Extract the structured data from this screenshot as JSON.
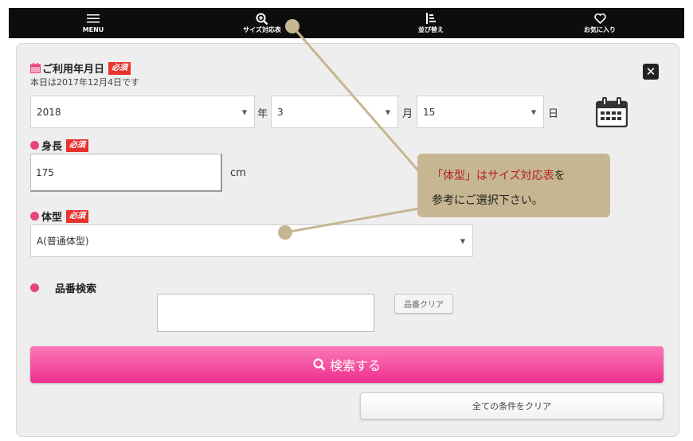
{
  "nav": {
    "items": [
      {
        "label": "MENU",
        "icon": "hamburger-menu-icon"
      },
      {
        "label": "サイズ対応表",
        "icon": "zoom-in-icon"
      },
      {
        "label": "並び替え",
        "icon": "sort-icon"
      },
      {
        "label": "お気に入り",
        "icon": "heart-icon"
      }
    ]
  },
  "birthdate": {
    "label": "ご利用年月日",
    "required": "必須",
    "today_text": "本日は2017年12月4日です",
    "year": {
      "value": "2018",
      "unit": "年"
    },
    "month": {
      "value": "3",
      "unit": "月"
    },
    "day": {
      "value": "15",
      "unit": "日"
    }
  },
  "height": {
    "label": "身長",
    "required": "必須",
    "value": "175",
    "unit": "cm"
  },
  "body_type": {
    "label": "体型",
    "required": "必須",
    "value": "A(普通体型)"
  },
  "product_search": {
    "label": "品番検索",
    "value": "",
    "clear_label": "品番クリア"
  },
  "search_button": {
    "label": "検索する"
  },
  "reset_button": {
    "label": "全ての条件をクリア"
  },
  "tooltip": {
    "highlight": "「体型」はサイズ対応表",
    "rest": "を",
    "line2": "参考にご選択下さい。"
  },
  "colors": {
    "accent": "#f0338e",
    "required": "#e8322c",
    "dot": "#e8467a",
    "tooltip": "#c6b692",
    "nav": "#0d0d0d"
  }
}
